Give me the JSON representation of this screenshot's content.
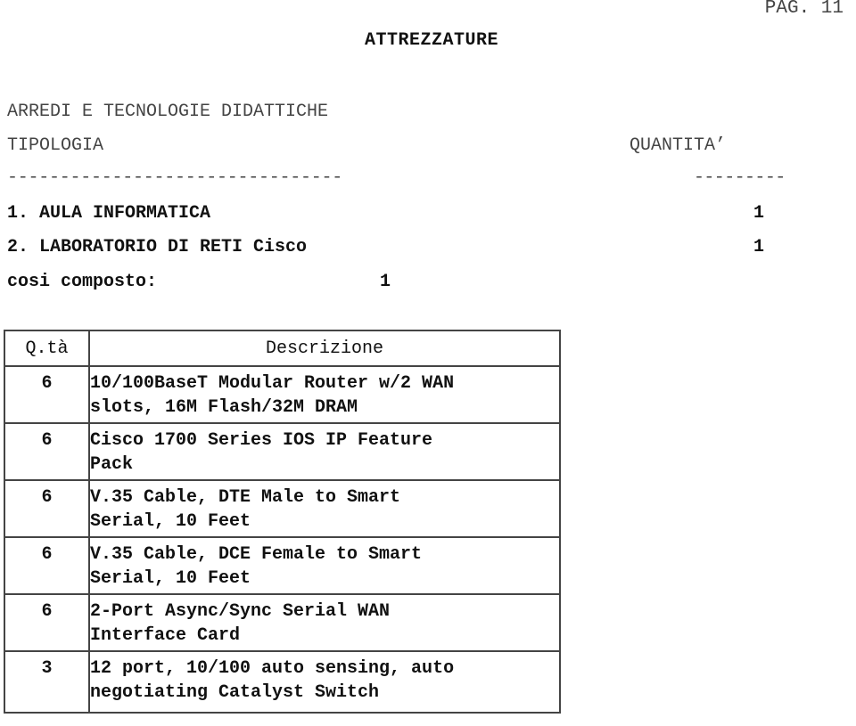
{
  "page": {
    "label": "PAG. 11"
  },
  "title": "ATTREZZATURE",
  "section_title": "ARREDI E TECNOLOGIE DIDATTICHE",
  "summary": {
    "col_tipologia": "TIPOLOGIA",
    "col_quantita": "QUANTITA’",
    "sep_left": "--------------------------------",
    "sep_right": "---------",
    "items": [
      {
        "label": "1. AULA INFORMATICA",
        "qty": "1"
      },
      {
        "label": "2. LABORATORIO DI RETI Cisco",
        "qty": "1"
      }
    ],
    "composto": {
      "label": "cosi composto:",
      "qty": "1"
    }
  },
  "equipment_table": {
    "headers": {
      "qty": "Q.tà",
      "desc": "Descrizione"
    },
    "rows": [
      {
        "qty": "6",
        "desc_line1": "10/100BaseT Modular Router w/2 WAN",
        "desc_line2": "slots, 16M Flash/32M DRAM"
      },
      {
        "qty": "6",
        "desc_line1": "Cisco 1700 Series IOS IP Feature",
        "desc_line2": "Pack"
      },
      {
        "qty": "6",
        "desc_line1": "V.35 Cable, DTE Male to Smart",
        "desc_line2": "Serial, 10 Feet"
      },
      {
        "qty": "6",
        "desc_line1": "V.35 Cable, DCE Female to Smart",
        "desc_line2": "Serial, 10 Feet"
      },
      {
        "qty": "6",
        "desc_line1": "2-Port Async/Sync Serial WAN",
        "desc_line2": "Interface Card"
      },
      {
        "qty": "3",
        "desc_line1": "12 port, 10/100 auto sensing, auto",
        "desc_line2": "negotiating Catalyst Switch"
      }
    ]
  }
}
